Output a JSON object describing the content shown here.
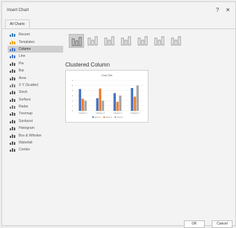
{
  "window": {
    "title": "Insert Chart",
    "help_glyph": "?",
    "close_glyph": "✕"
  },
  "tabs": [
    {
      "label": "All Charts"
    }
  ],
  "sidebar": {
    "items": [
      {
        "label": "Recent",
        "icon": "recent-icon",
        "color": "#2e75b6"
      },
      {
        "label": "Templates",
        "icon": "templates-icon",
        "color": "#f0a30a"
      },
      {
        "label": "Column",
        "icon": "column-chart-icon",
        "color": "#4472c4",
        "active": true
      },
      {
        "label": "Line",
        "icon": "line-chart-icon",
        "color": "#4472c4"
      },
      {
        "label": "Pie",
        "icon": "pie-chart-icon",
        "color": "#555555"
      },
      {
        "label": "Bar",
        "icon": "bar-chart-icon",
        "color": "#555555"
      },
      {
        "label": "Area",
        "icon": "area-chart-icon",
        "color": "#555555"
      },
      {
        "label": "X Y (Scatter)",
        "icon": "scatter-chart-icon",
        "color": "#7f7f7f"
      },
      {
        "label": "Stock",
        "icon": "stock-chart-icon",
        "color": "#555555"
      },
      {
        "label": "Surface",
        "icon": "surface-chart-icon",
        "color": "#555555"
      },
      {
        "label": "Radar",
        "icon": "radar-chart-icon",
        "color": "#777777"
      },
      {
        "label": "Treemap",
        "icon": "treemap-chart-icon",
        "color": "#555555"
      },
      {
        "label": "Sunburst",
        "icon": "sunburst-chart-icon",
        "color": "#555555"
      },
      {
        "label": "Histogram",
        "icon": "histogram-chart-icon",
        "color": "#555555"
      },
      {
        "label": "Box & Whisker",
        "icon": "box-whisker-chart-icon",
        "color": "#555555"
      },
      {
        "label": "Waterfall",
        "icon": "waterfall-chart-icon",
        "color": "#555555"
      },
      {
        "label": "Combo",
        "icon": "combo-chart-icon",
        "color": "#555555"
      }
    ]
  },
  "main": {
    "subtypes": [
      {
        "name": "clustered-column",
        "active": true
      },
      {
        "name": "stacked-column"
      },
      {
        "name": "100-stacked-column"
      },
      {
        "name": "3d-clustered-column"
      },
      {
        "name": "3d-stacked-column"
      },
      {
        "name": "3d-100-stacked-column"
      },
      {
        "name": "3d-column"
      }
    ],
    "selected_title": "Clustered Column"
  },
  "preview": {
    "chart_title": "Chart Title",
    "categories": [
      "Category 1",
      "Category 2",
      "Category 3",
      "Category 4"
    ],
    "series": [
      {
        "name": "Series 1",
        "color": "#4472c4",
        "values": [
          4.3,
          2.5,
          3.5,
          4.5
        ]
      },
      {
        "name": "Series 2",
        "color": "#ed7d31",
        "values": [
          2.4,
          4.4,
          1.8,
          2.8
        ]
      },
      {
        "name": "Series 3",
        "color": "#a5a5a5",
        "values": [
          2.0,
          2.0,
          3.0,
          5.0
        ]
      }
    ],
    "ymax": 6
  },
  "footer": {
    "ok_label": "OK",
    "cancel_label": "Cancel"
  }
}
